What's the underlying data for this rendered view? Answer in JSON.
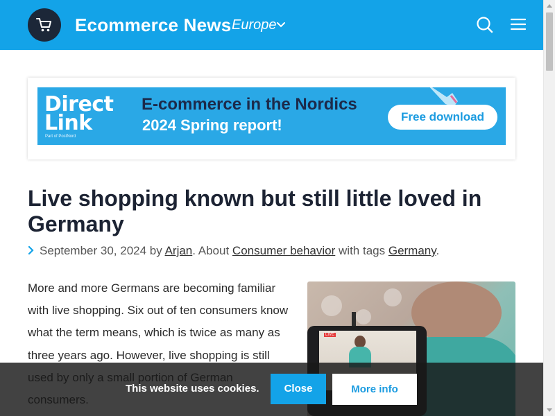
{
  "header": {
    "site_title": "Ecommerce News",
    "region": "Europe",
    "icons": [
      "cart-icon",
      "chevron-down-icon",
      "search-icon",
      "menu-icon"
    ],
    "bg_color": "#13a3e8"
  },
  "banner": {
    "logo_line1": "Direct",
    "logo_line2": "Link",
    "logo_sub": "Part of PostNord",
    "headline": "E-commerce in the Nordics",
    "subline": "2024 Spring report!",
    "cta": "Free download"
  },
  "article": {
    "title": "Live shopping known but still little loved in Germany",
    "date": "September 30, 2024",
    "by": "by",
    "author": "Arjan",
    "about": ". About",
    "category": "Consumer behavior",
    "with_tags": "with tags",
    "tag": "Germany",
    "end": ".",
    "body": "More and more Germans are becoming familiar with live shopping. Six out of ten consumers know what the term means, which is twice as many as three years ago. However, live shopping is still used by only a small portion of German consumers.",
    "photo_live_label": "LIVE"
  },
  "cookie": {
    "message": "This website uses cookies.",
    "close_label": "Close",
    "more_label": "More info"
  }
}
